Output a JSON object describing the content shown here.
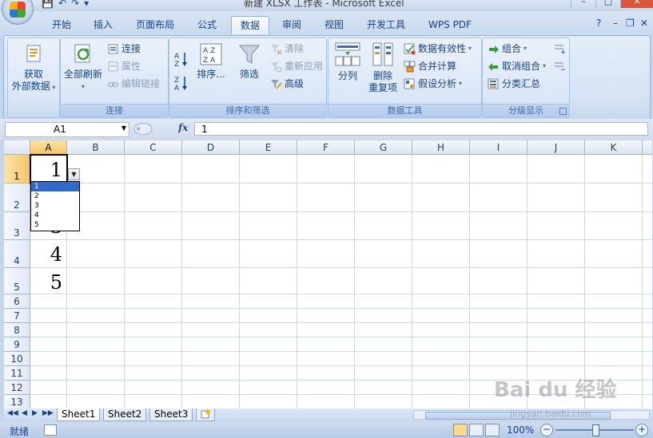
{
  "window": {
    "title": "新建 XLSX 工作表 - Microsoft Excel",
    "controls": [
      "–",
      "□",
      "✕"
    ]
  },
  "quick_access": [
    "💾",
    "↶",
    "↷",
    "▾"
  ],
  "ribbon_tabs": [
    {
      "label": "开始",
      "active": false
    },
    {
      "label": "插入",
      "active": false
    },
    {
      "label": "页面布局",
      "active": false
    },
    {
      "label": "公式",
      "active": false
    },
    {
      "label": "数据",
      "active": true
    },
    {
      "label": "审阅",
      "active": false
    },
    {
      "label": "视图",
      "active": false
    },
    {
      "label": "开发工具",
      "active": false
    },
    {
      "label": "WPS PDF",
      "active": false
    }
  ],
  "ribbon_help": {
    "help": "?",
    "min": "–",
    "restore": "❐",
    "close": "✕"
  },
  "groups": {
    "external": {
      "label_line1": "获取",
      "label_line2": "外部数据"
    },
    "connections": {
      "label": "连接",
      "refresh_label": "全部刷新",
      "items": [
        "连接",
        "属性",
        "编辑链接"
      ]
    },
    "sort_filter": {
      "label": "排序和筛选",
      "sort_label": "排序...",
      "filter_label": "筛选",
      "items": [
        "清除",
        "重新应用",
        "高级"
      ]
    },
    "data_tools": {
      "label": "数据工具",
      "split_label": "分列",
      "dedupe_line1": "删除",
      "dedupe_line2": "重复项",
      "items": [
        "数据有效性",
        "合并计算",
        "假设分析"
      ]
    },
    "outline": {
      "label": "分级显示",
      "items": [
        "组合",
        "取消组合",
        "分类汇总"
      ]
    }
  },
  "formula_bar": {
    "name_box": "A1",
    "fx": "fx",
    "value": "1"
  },
  "grid": {
    "columns": [
      "A",
      "B",
      "C",
      "D",
      "E",
      "F",
      "G",
      "H",
      "I",
      "J",
      "K"
    ],
    "rows": [
      "1",
      "2",
      "3",
      "4",
      "5",
      "6",
      "7",
      "8",
      "9",
      "10",
      "11",
      "12",
      "13"
    ],
    "cells_col_a": [
      "1",
      "2",
      "3",
      "4",
      "5"
    ],
    "dropdown_options": [
      "1",
      "2",
      "3",
      "4",
      "5"
    ],
    "dropdown_selected": "1"
  },
  "sheets": [
    {
      "name": "Sheet1",
      "active": true
    },
    {
      "name": "Sheet2",
      "active": false
    },
    {
      "name": "Sheet3",
      "active": false
    }
  ],
  "status": {
    "ready": "就绪",
    "zoom": "100%"
  },
  "watermark": {
    "main": "Bai du 经验",
    "sub": "jingyan.baidu.com"
  }
}
